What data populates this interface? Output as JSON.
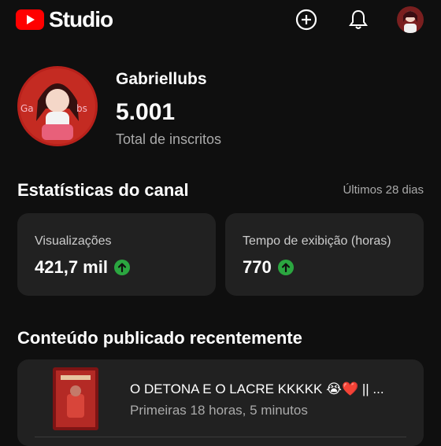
{
  "app": {
    "brand": "Studio",
    "accent": "#ff0000",
    "icons": [
      "create-icon",
      "bell-icon",
      "avatar"
    ]
  },
  "channel": {
    "name": "Gabriellubs",
    "subscribers": "5.001",
    "subscribers_label": "Total de inscritos",
    "avatar_text": "Gabriellubs"
  },
  "stats": {
    "title": "Estatísticas do canal",
    "period": "Últimos 28 dias",
    "cards": [
      {
        "label": "Visualizações",
        "value": "421,7 mil",
        "trend": "up"
      },
      {
        "label": "Tempo de exibição (horas)",
        "value": "770",
        "trend": "up"
      }
    ],
    "trend_color": "#2ba640"
  },
  "recent": {
    "title": "Conteúdo publicado recentemente",
    "items": [
      {
        "title": "O DETONA E O LACRE KKKKK 😭❤️ || ...",
        "meta": "Primeiras 18 horas, 5 minutos"
      }
    ]
  }
}
